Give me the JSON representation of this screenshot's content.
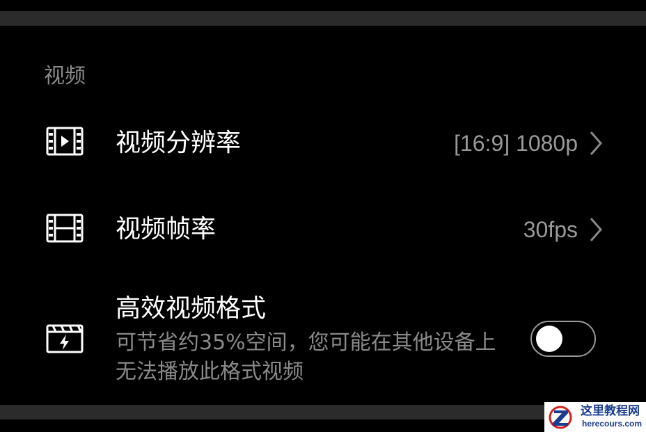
{
  "section": {
    "title": "视频"
  },
  "settings": [
    {
      "label": "视频分辨率",
      "value": "[16:9] 1080p",
      "icon": "video-play-icon"
    },
    {
      "label": "视频帧率",
      "value": "30fps",
      "icon": "film-strip-icon"
    },
    {
      "label": "高效视频格式",
      "description": "可节省约35%空间，您可能在其他设备上无法播放此格式视频",
      "icon": "clapper-flash-icon",
      "toggle_on": false
    }
  ],
  "watermark": {
    "name": "这里教程网",
    "domain": "herecours.com"
  },
  "colors": {
    "background": "#000000",
    "divider": "#2b2b2b",
    "secondary_text": "#8a8a8a",
    "watermark_blue": "#1a3d8f",
    "watermark_red": "#d02020"
  }
}
